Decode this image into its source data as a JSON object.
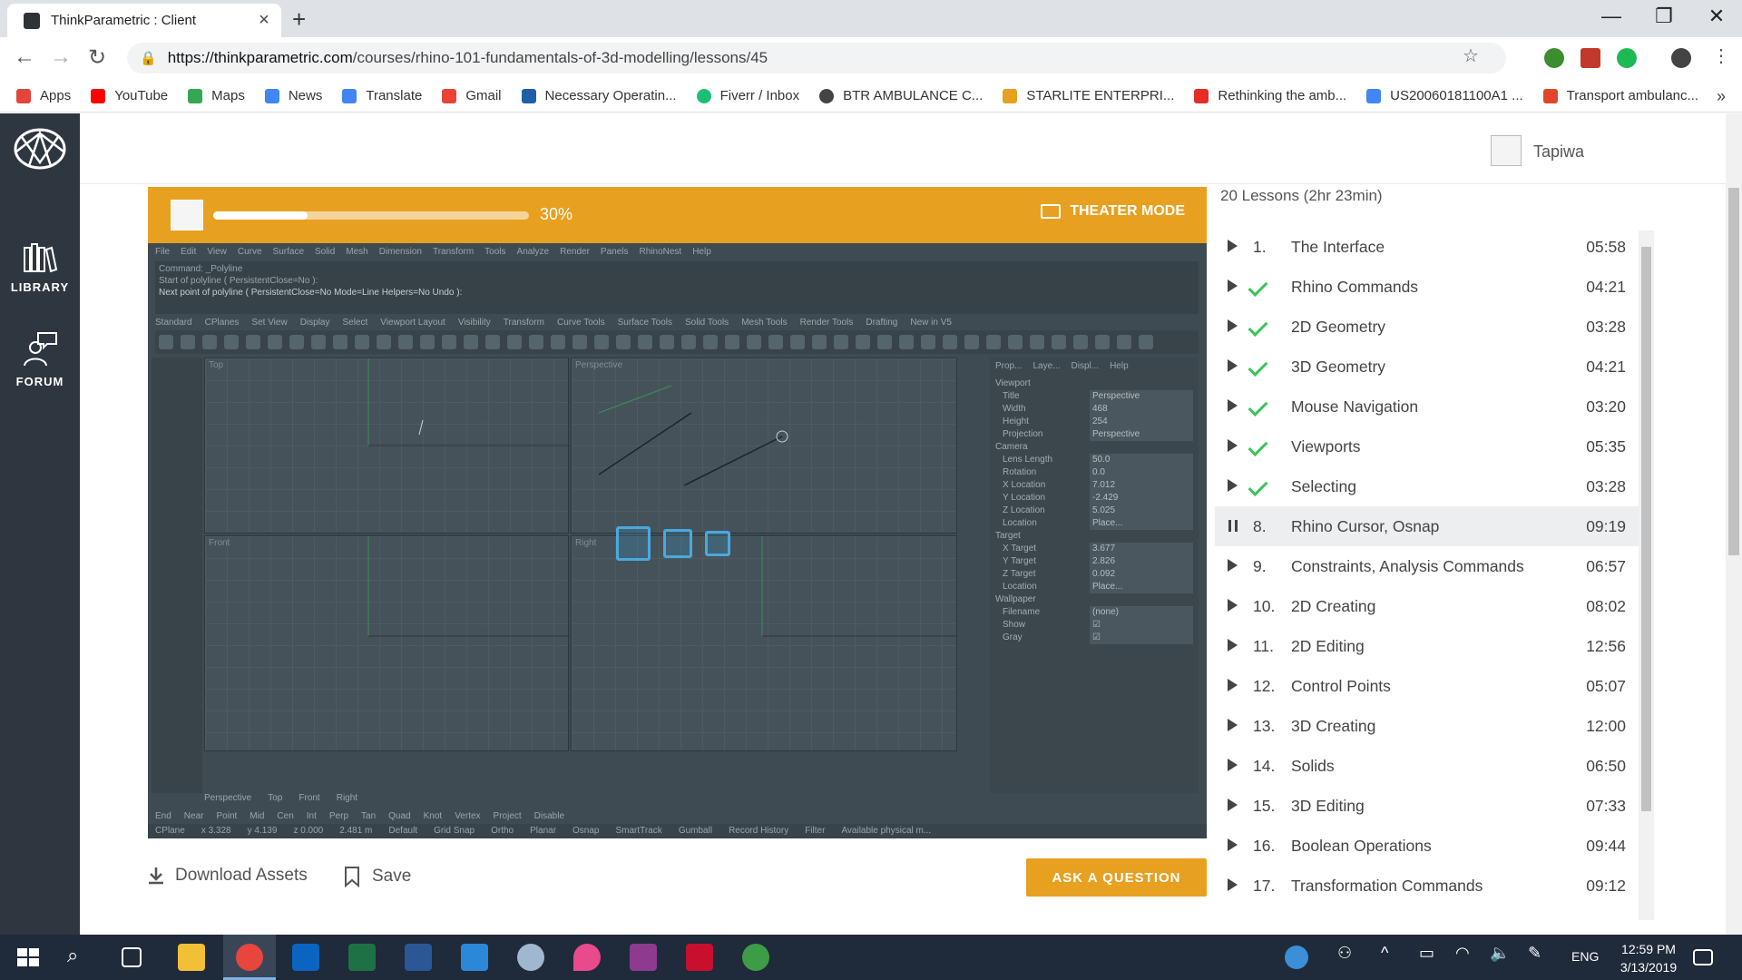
{
  "browser": {
    "tab_title": "ThinkParametric : Client",
    "url_host": "https://thinkparametric.com",
    "url_path": "/courses/rhino-101-fundamentals-of-3d-modelling/lessons/45",
    "bookmarks": [
      {
        "label": "Apps",
        "color": "#e2453c"
      },
      {
        "label": "YouTube",
        "color": "#ff0000"
      },
      {
        "label": "Maps",
        "color": "#34a853"
      },
      {
        "label": "News",
        "color": "#4285f4"
      },
      {
        "label": "Translate",
        "color": "#4285f4"
      },
      {
        "label": "Gmail",
        "color": "#ea4335"
      },
      {
        "label": "Necessary Operatin...",
        "color": "#1f5fa8"
      },
      {
        "label": "Fiverr / Inbox",
        "color": "#1dbf73"
      },
      {
        "label": "BTR AMBULANCE C...",
        "color": "#444444"
      },
      {
        "label": "STARLITE ENTERPRI...",
        "color": "#e8a021"
      },
      {
        "label": "Rethinking the amb...",
        "color": "#e52d27"
      },
      {
        "label": "US20060181100A1 ...",
        "color": "#4285f4"
      },
      {
        "label": "Transport ambulanc...",
        "color": "#e0452b"
      }
    ]
  },
  "sidebar": {
    "library": "LIBRARY",
    "forum": "FORUM"
  },
  "header": {
    "user_name": "Tapiwa"
  },
  "player": {
    "progress_percent": 30,
    "progress_label": "30%",
    "theater_mode": "THEATER MODE",
    "rhino": {
      "menu": [
        "File",
        "Edit",
        "View",
        "Curve",
        "Surface",
        "Solid",
        "Mesh",
        "Dimension",
        "Transform",
        "Tools",
        "Analyze",
        "Render",
        "Panels",
        "RhinoNest",
        "Help"
      ],
      "cmd_line1": "Command: _Polyline",
      "cmd_line2": "Start of polyline ( PersistentClose=No ):",
      "cmd_line3": "Next point of polyline ( PersistentClose=No  Mode=Line  Helpers=No  Undo ):",
      "tabs": [
        "Standard",
        "CPlanes",
        "Set View",
        "Display",
        "Select",
        "Viewport Layout",
        "Visibility",
        "Transform",
        "Curve Tools",
        "Surface Tools",
        "Solid Tools",
        "Mesh Tools",
        "Render Tools",
        "Drafting",
        "New in V5"
      ],
      "viewports": {
        "top": "Top",
        "perspective": "Perspective",
        "front": "Front",
        "right": "Right"
      },
      "panel_tabs": [
        "Prop...",
        "Laye...",
        "Displ...",
        "Help"
      ],
      "props": {
        "viewport": "Viewport",
        "title_k": "Title",
        "title_v": "Perspective",
        "width_k": "Width",
        "width_v": "468",
        "height_k": "Height",
        "height_v": "254",
        "projection_k": "Projection",
        "projection_v": "Perspective",
        "camera": "Camera",
        "lens_k": "Lens Length",
        "lens_v": "50.0",
        "rotation_k": "Rotation",
        "rotation_v": "0.0",
        "xloc_k": "X Location",
        "xloc_v": "7.012",
        "yloc_k": "Y Location",
        "yloc_v": "-2.429",
        "zloc_k": "Z Location",
        "zloc_v": "5.025",
        "loc_k": "Location",
        "loc_v": "Place...",
        "target": "Target",
        "xt_k": "X Target",
        "xt_v": "3.677",
        "yt_k": "Y Target",
        "yt_v": "2.826",
        "zt_k": "Z Target",
        "zt_v": "0.092",
        "tloc_k": "Location",
        "tloc_v": "Place...",
        "wallpaper": "Wallpaper",
        "file_k": "Filename",
        "file_v": "(none)",
        "show_k": "Show",
        "gray_k": "Gray"
      },
      "vptabs": [
        "Perspective",
        "Top",
        "Front",
        "Right"
      ],
      "osnaps": [
        "End",
        "Near",
        "Point",
        "Mid",
        "Cen",
        "Int",
        "Perp",
        "Tan",
        "Quad",
        "Knot",
        "Vertex",
        "Project",
        "Disable"
      ],
      "status": [
        "CPlane",
        "x 3.328",
        "y 4.139",
        "z 0.000",
        "2.481 m",
        "Default",
        "Grid Snap",
        "Ortho",
        "Planar",
        "Osnap",
        "SmartTrack",
        "Gumball",
        "Record History",
        "Filter",
        "Available physical m..."
      ]
    }
  },
  "actions": {
    "download": "Download Assets",
    "save": "Save",
    "ask": "ASK A QUESTION"
  },
  "lessons": {
    "header": "20 Lessons (2hr 23min)",
    "items": [
      {
        "num": "1.",
        "title": "The Interface",
        "duration": "05:58",
        "done": false,
        "active": false
      },
      {
        "num": "",
        "title": "Rhino Commands",
        "duration": "04:21",
        "done": true,
        "active": false
      },
      {
        "num": "",
        "title": "2D Geometry",
        "duration": "03:28",
        "done": true,
        "active": false
      },
      {
        "num": "",
        "title": "3D Geometry",
        "duration": "04:21",
        "done": true,
        "active": false
      },
      {
        "num": "",
        "title": "Mouse Navigation",
        "duration": "03:20",
        "done": true,
        "active": false
      },
      {
        "num": "",
        "title": "Viewports",
        "duration": "05:35",
        "done": true,
        "active": false
      },
      {
        "num": "",
        "title": "Selecting",
        "duration": "03:28",
        "done": true,
        "active": false
      },
      {
        "num": "8.",
        "title": "Rhino Cursor, Osnap",
        "duration": "09:19",
        "done": false,
        "active": true
      },
      {
        "num": "9.",
        "title": "Constraints, Analysis Commands",
        "duration": "06:57",
        "done": false,
        "active": false
      },
      {
        "num": "10.",
        "title": "2D Creating",
        "duration": "08:02",
        "done": false,
        "active": false
      },
      {
        "num": "11.",
        "title": "2D Editing",
        "duration": "12:56",
        "done": false,
        "active": false
      },
      {
        "num": "12.",
        "title": "Control Points",
        "duration": "05:07",
        "done": false,
        "active": false
      },
      {
        "num": "13.",
        "title": "3D Creating",
        "duration": "12:00",
        "done": false,
        "active": false
      },
      {
        "num": "14.",
        "title": "Solids",
        "duration": "06:50",
        "done": false,
        "active": false
      },
      {
        "num": "15.",
        "title": "3D Editing",
        "duration": "07:33",
        "done": false,
        "active": false
      },
      {
        "num": "16.",
        "title": "Boolean Operations",
        "duration": "09:44",
        "done": false,
        "active": false
      },
      {
        "num": "17.",
        "title": "Transformation Commands",
        "duration": "09:12",
        "done": false,
        "active": false
      }
    ]
  },
  "taskbar": {
    "lang": "ENG",
    "time": "12:59 PM",
    "date": "3/13/2019"
  }
}
